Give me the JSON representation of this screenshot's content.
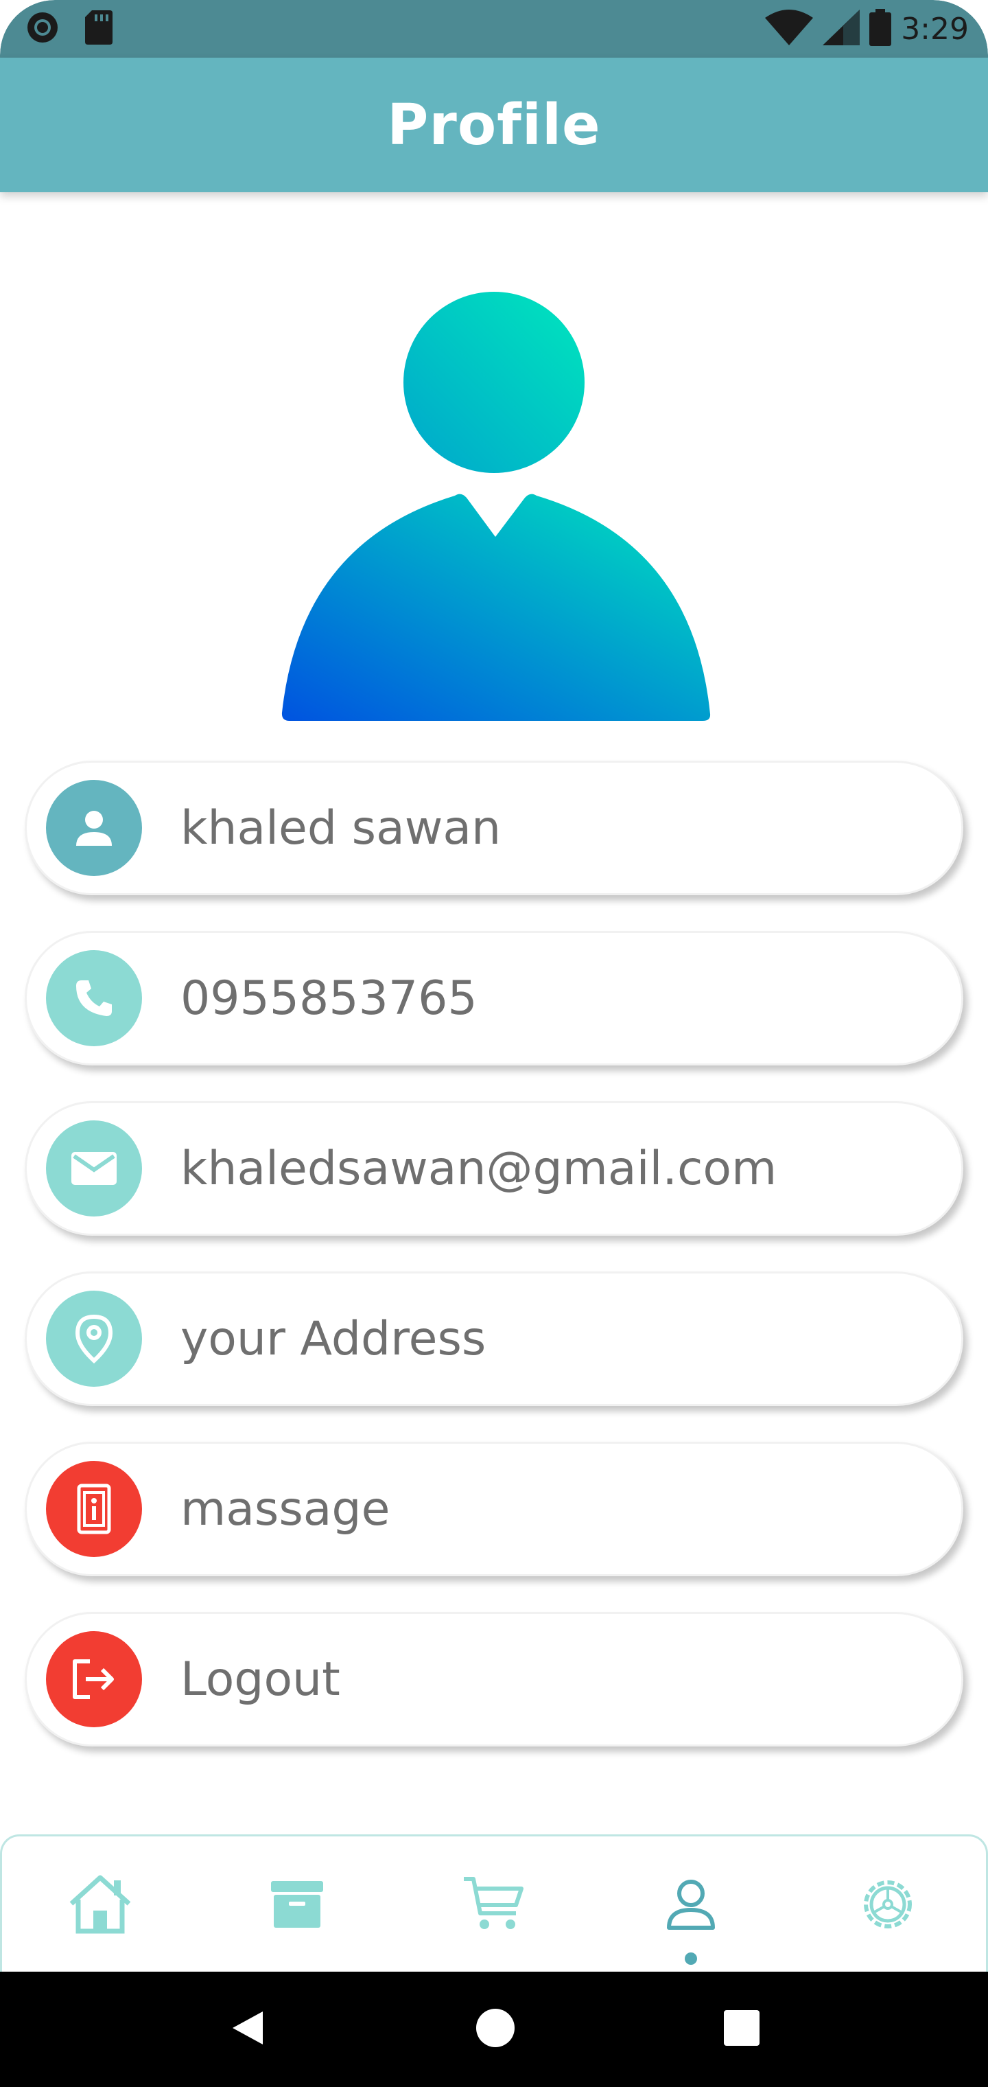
{
  "status_bar": {
    "time": "3:29",
    "icons": [
      "sync-icon",
      "sd-card-icon",
      "wifi-icon",
      "cellular-signal-icon",
      "battery-icon"
    ]
  },
  "app_bar": {
    "title": "Profile"
  },
  "avatar": {
    "icon": "person-avatar-icon",
    "gradient_start": "#0053e0",
    "gradient_end": "#00e6bd"
  },
  "profile_items": [
    {
      "label": "khaled sawan",
      "icon": "person-icon",
      "color": "#64b5bf"
    },
    {
      "label": "0955853765",
      "icon": "phone-icon",
      "color": "#8cdad3"
    },
    {
      "label": "khaledsawan@gmail.com",
      "icon": "email-icon",
      "color": "#8cdad3"
    },
    {
      "label": "your Address",
      "icon": "location-pin-icon",
      "color": "#8cdad3"
    },
    {
      "label": "massage",
      "icon": "message-device-icon",
      "color": "#f23d32"
    },
    {
      "label": "Logout",
      "icon": "logout-icon",
      "color": "#f23d32"
    }
  ],
  "bottom_nav": {
    "items": [
      {
        "name": "home",
        "icon": "home-icon",
        "active": false
      },
      {
        "name": "archive",
        "icon": "archive-box-icon",
        "active": false
      },
      {
        "name": "cart",
        "icon": "shopping-cart-icon",
        "active": false
      },
      {
        "name": "profile",
        "icon": "profile-icon",
        "active": true
      },
      {
        "name": "settings",
        "icon": "settings-gear-icon",
        "active": false
      }
    ],
    "accent": "#52a9b4",
    "inactive": "#8cdad3"
  },
  "system_nav": {
    "icons": [
      "back-icon",
      "home-circle-icon",
      "recents-icon"
    ]
  },
  "colors": {
    "status_bar": "#4d8a93",
    "app_bar": "#64b5bf",
    "text": "#6f6f6f"
  }
}
